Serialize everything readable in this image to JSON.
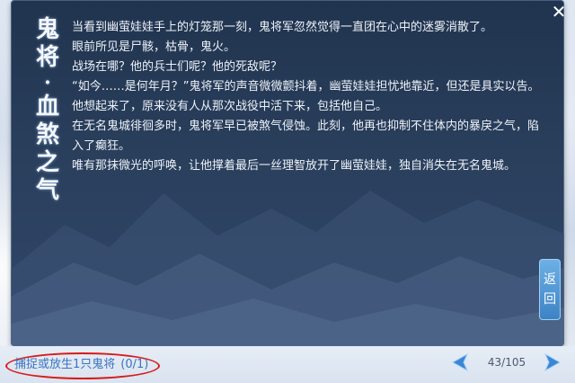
{
  "dialog": {
    "title_chars": [
      "鬼",
      "将",
      "·",
      "血",
      "煞",
      "之",
      "气"
    ],
    "paragraphs": [
      "当看到幽萤娃娃手上的灯笼那一刻，鬼将军忽然觉得一直团在心中的迷雾消散了。",
      "眼前所见是尸骸，枯骨，鬼火。",
      "战场在哪？他的兵士们呢？他的死敌呢？",
      "“如今……是何年月？”鬼将军的声音微微颤抖着，幽萤娃娃担忧地靠近，但还是具实以告。",
      "他想起来了，原来没有人从那次战役中活下来，包括他自己。",
      "在无名鬼城徘徊多时，鬼将军早已被煞气侵蚀。此刻，他再也抑制不住体内的暴戾之气，陷入了癫狂。",
      "唯有那抹微光的呼唤，让他撑着最后一丝理智放开了幽萤娃娃，独自消失在无名鬼城。"
    ],
    "back_button": [
      "返",
      "回"
    ],
    "close_icon": "close-icon"
  },
  "footer": {
    "quest_text": "捕捉或放生1只鬼将",
    "quest_progress": "(0/1)",
    "page": "43/105",
    "prev_icon": "arrow-left-icon",
    "next_icon": "arrow-right-icon"
  },
  "colors": {
    "panel": "#2a3f5c",
    "quest_text": "#3b74c0",
    "highlight_circle": "#d81a1a",
    "arrow": "#3a86d8"
  }
}
